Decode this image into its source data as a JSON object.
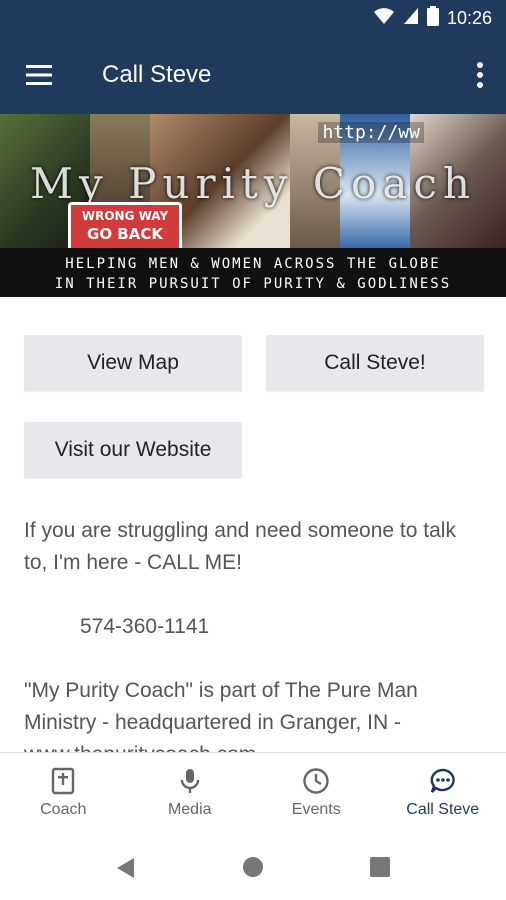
{
  "status_bar": {
    "time": "10:26"
  },
  "app_bar": {
    "title": "Call Steve"
  },
  "banner": {
    "brand": "My Purity Coach",
    "sign_line1": "WRONG WAY",
    "sign_line2": "GO BACK",
    "url_fragment": "http://ww",
    "tagline_line1": "HELPING MEN & WOMEN ACROSS THE GLOBE",
    "tagline_line2": "IN THEIR PURSUIT OF PURITY & GODLINESS"
  },
  "buttons": {
    "view_map": "View Map",
    "call_steve": "Call Steve!",
    "visit_website": "Visit our Website"
  },
  "content": {
    "paragraph1": "If you are struggling and need someone to talk to, I'm here - CALL ME!",
    "phone": "574-360-1141",
    "paragraph2": "\"My Purity Coach\" is part of The Pure Man Ministry - headquartered in Granger, IN - www.thepuritycoach.com"
  },
  "bottom_nav": {
    "items": [
      {
        "label": "Coach",
        "icon": "bible-icon"
      },
      {
        "label": "Media",
        "icon": "microphone-icon"
      },
      {
        "label": "Events",
        "icon": "clock-icon"
      },
      {
        "label": "Call Steve",
        "icon": "chat-bubble-icon"
      }
    ],
    "active_index": 3
  },
  "colors": {
    "primary": "#1f3a5c",
    "button_bg": "#e6e8ec"
  }
}
